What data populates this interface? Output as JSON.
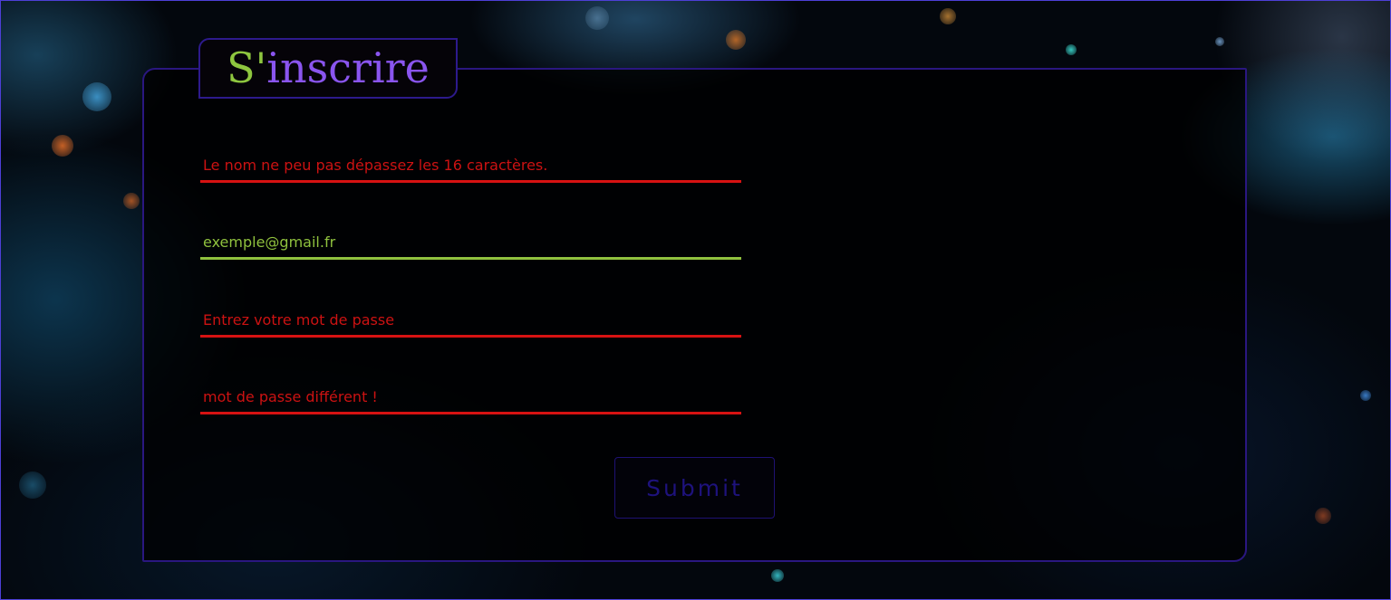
{
  "form": {
    "title_first_letter": "S'",
    "title_rest": "inscrire",
    "fields": [
      {
        "text": "Le nom ne peu pas dépassez les 16 caractères.",
        "state": "error"
      },
      {
        "text": "exemple@gmail.fr",
        "state": "valid"
      },
      {
        "text": "Entrez votre mot de passe",
        "state": "error"
      },
      {
        "text": "mot de passe différent !",
        "state": "error"
      }
    ],
    "submit_label": "Submit"
  },
  "colors": {
    "accent_green": "#8ec63f",
    "accent_purple": "#8a55ef",
    "error_red": "#d71212",
    "frame_blue": "#2a1780"
  }
}
